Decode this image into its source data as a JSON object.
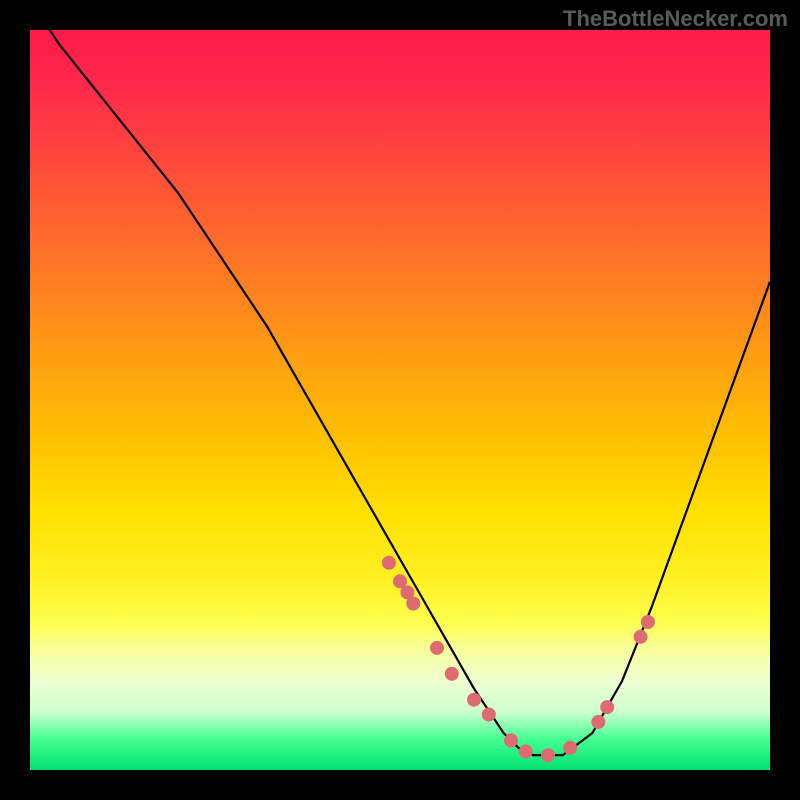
{
  "watermark": "TheBottleNecker.com",
  "chart_data": {
    "type": "line",
    "title": "",
    "xlabel": "",
    "ylabel": "",
    "xlim": [
      0,
      100
    ],
    "ylim": [
      0,
      100
    ],
    "series": [
      {
        "name": "bottleneck-curve",
        "x": [
          0,
          4,
          8,
          12,
          16,
          20,
          24,
          28,
          32,
          36,
          40,
          44,
          48,
          52,
          56,
          60,
          62,
          64,
          66,
          68,
          72,
          76,
          80,
          84,
          88,
          92,
          96,
          100
        ],
        "y": [
          104,
          98,
          93,
          88,
          83,
          78,
          72,
          66,
          60,
          53,
          46,
          39,
          32,
          25,
          18,
          11,
          8,
          5,
          3,
          2,
          2,
          5,
          12,
          22,
          33,
          44,
          55,
          66
        ]
      }
    ],
    "markers": {
      "name": "data-points",
      "x": [
        48.5,
        50.0,
        51.0,
        51.8,
        55.0,
        57.0,
        60.0,
        62.0,
        65.0,
        67.0,
        70.0,
        73.0,
        76.8,
        78.0,
        82.5,
        83.5
      ],
      "y": [
        28.0,
        25.5,
        24.0,
        22.5,
        16.5,
        13.0,
        9.5,
        7.5,
        4.0,
        2.5,
        2.0,
        3.0,
        6.5,
        8.5,
        18.0,
        20.0
      ],
      "color": "#e06a72",
      "radius_px": 7
    },
    "gradient_stops": [
      {
        "pos": 0.0,
        "color": "#ff1a4a"
      },
      {
        "pos": 0.5,
        "color": "#ffd000"
      },
      {
        "pos": 0.85,
        "color": "#fcff80"
      },
      {
        "pos": 1.0,
        "color": "#00e070"
      }
    ]
  }
}
